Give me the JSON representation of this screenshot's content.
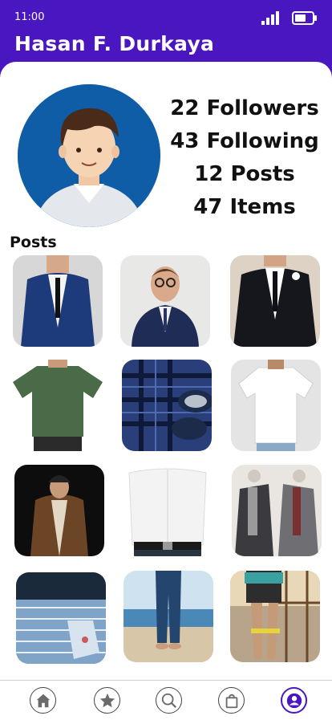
{
  "status_bar": {
    "time": "11:00",
    "signal_icon": "signal-bars-icon",
    "battery_icon": "battery-icon"
  },
  "profile": {
    "name": "Hasan F. Durkaya",
    "avatar_icon": "user-avatar-illustration",
    "stats": {
      "followers": "22 Followers",
      "following": "43 Following",
      "posts": "12 Posts",
      "items": "47 Items"
    }
  },
  "posts": {
    "heading": "Posts",
    "items": [
      {
        "image": "man-in-navy-suit-and-tie"
      },
      {
        "image": "smiling-man-with-glasses-in-navy-suit"
      },
      {
        "image": "man-in-black-suit-with-boutonniere"
      },
      {
        "image": "man-in-green-t-shirt"
      },
      {
        "image": "plaid-shirt-and-navy-shoes"
      },
      {
        "image": "man-in-white-t-shirt"
      },
      {
        "image": "man-in-brown-coat-and-beanie"
      },
      {
        "image": "man-in-white-shirt-and-black-belt"
      },
      {
        "image": "suits-and-scarves-on-mannequins"
      },
      {
        "image": "folded-patterned-shirts"
      },
      {
        "image": "man-in-jeans-on-beach"
      },
      {
        "image": "resistance-band-exercise-outdoors"
      }
    ]
  },
  "tab_bar": {
    "accent": "#4a16c0",
    "tabs": [
      {
        "icon": "home-icon",
        "active": false
      },
      {
        "icon": "star-icon",
        "active": false
      },
      {
        "icon": "search-icon",
        "active": false
      },
      {
        "icon": "shopping-bag-icon",
        "active": false
      },
      {
        "icon": "profile-icon",
        "active": true
      }
    ]
  },
  "colors": {
    "header_background": "#4a16c0",
    "avatar_background": "#0e5da6"
  }
}
